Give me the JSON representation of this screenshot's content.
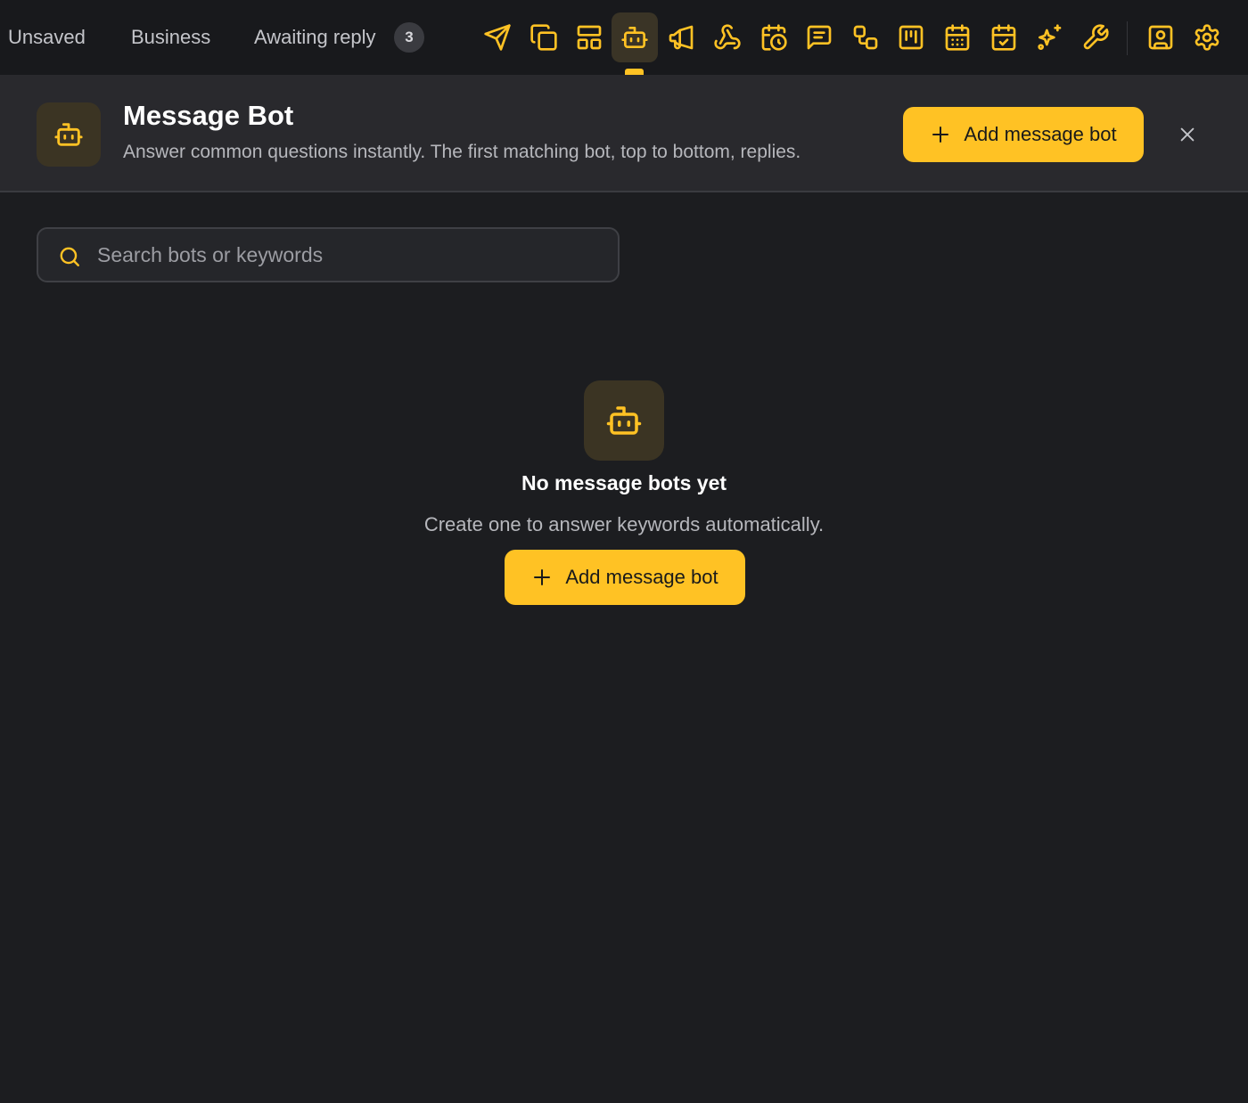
{
  "colors": {
    "accent": "#ffc224",
    "background": "#1c1d20",
    "topbar": "#18191c",
    "header": "#29292d"
  },
  "tabs": [
    {
      "label": "Unsaved"
    },
    {
      "label": "Business"
    },
    {
      "label": "Awaiting reply",
      "badge": "3"
    }
  ],
  "toolbar": {
    "tools": [
      {
        "icon": "send-icon"
      },
      {
        "icon": "copy-icon"
      },
      {
        "icon": "layout-icon"
      },
      {
        "icon": "bot-icon",
        "active": true
      },
      {
        "icon": "megaphone-icon"
      },
      {
        "icon": "webhook-icon"
      },
      {
        "icon": "calendar-clock-icon"
      },
      {
        "icon": "message-square-icon"
      },
      {
        "icon": "workflow-icon"
      },
      {
        "icon": "kanban-icon"
      },
      {
        "icon": "calendar-icon"
      },
      {
        "icon": "calendar-check-icon"
      },
      {
        "icon": "sparkles-icon"
      },
      {
        "icon": "wrench-icon"
      },
      {
        "icon": "contact-icon"
      },
      {
        "icon": "settings-icon"
      }
    ]
  },
  "header": {
    "icon": "bot-icon",
    "title": "Message Bot",
    "subtitle": "Answer common questions instantly. The first matching bot, top to bottom, replies.",
    "add_button": "Add message bot",
    "close_icon": "close-icon"
  },
  "search": {
    "placeholder": "Search bots or keywords",
    "value": ""
  },
  "empty_state": {
    "icon": "bot-icon",
    "title": "No message bots yet",
    "subtitle": "Create one to answer keywords automatically.",
    "add_button": "Add message bot"
  }
}
